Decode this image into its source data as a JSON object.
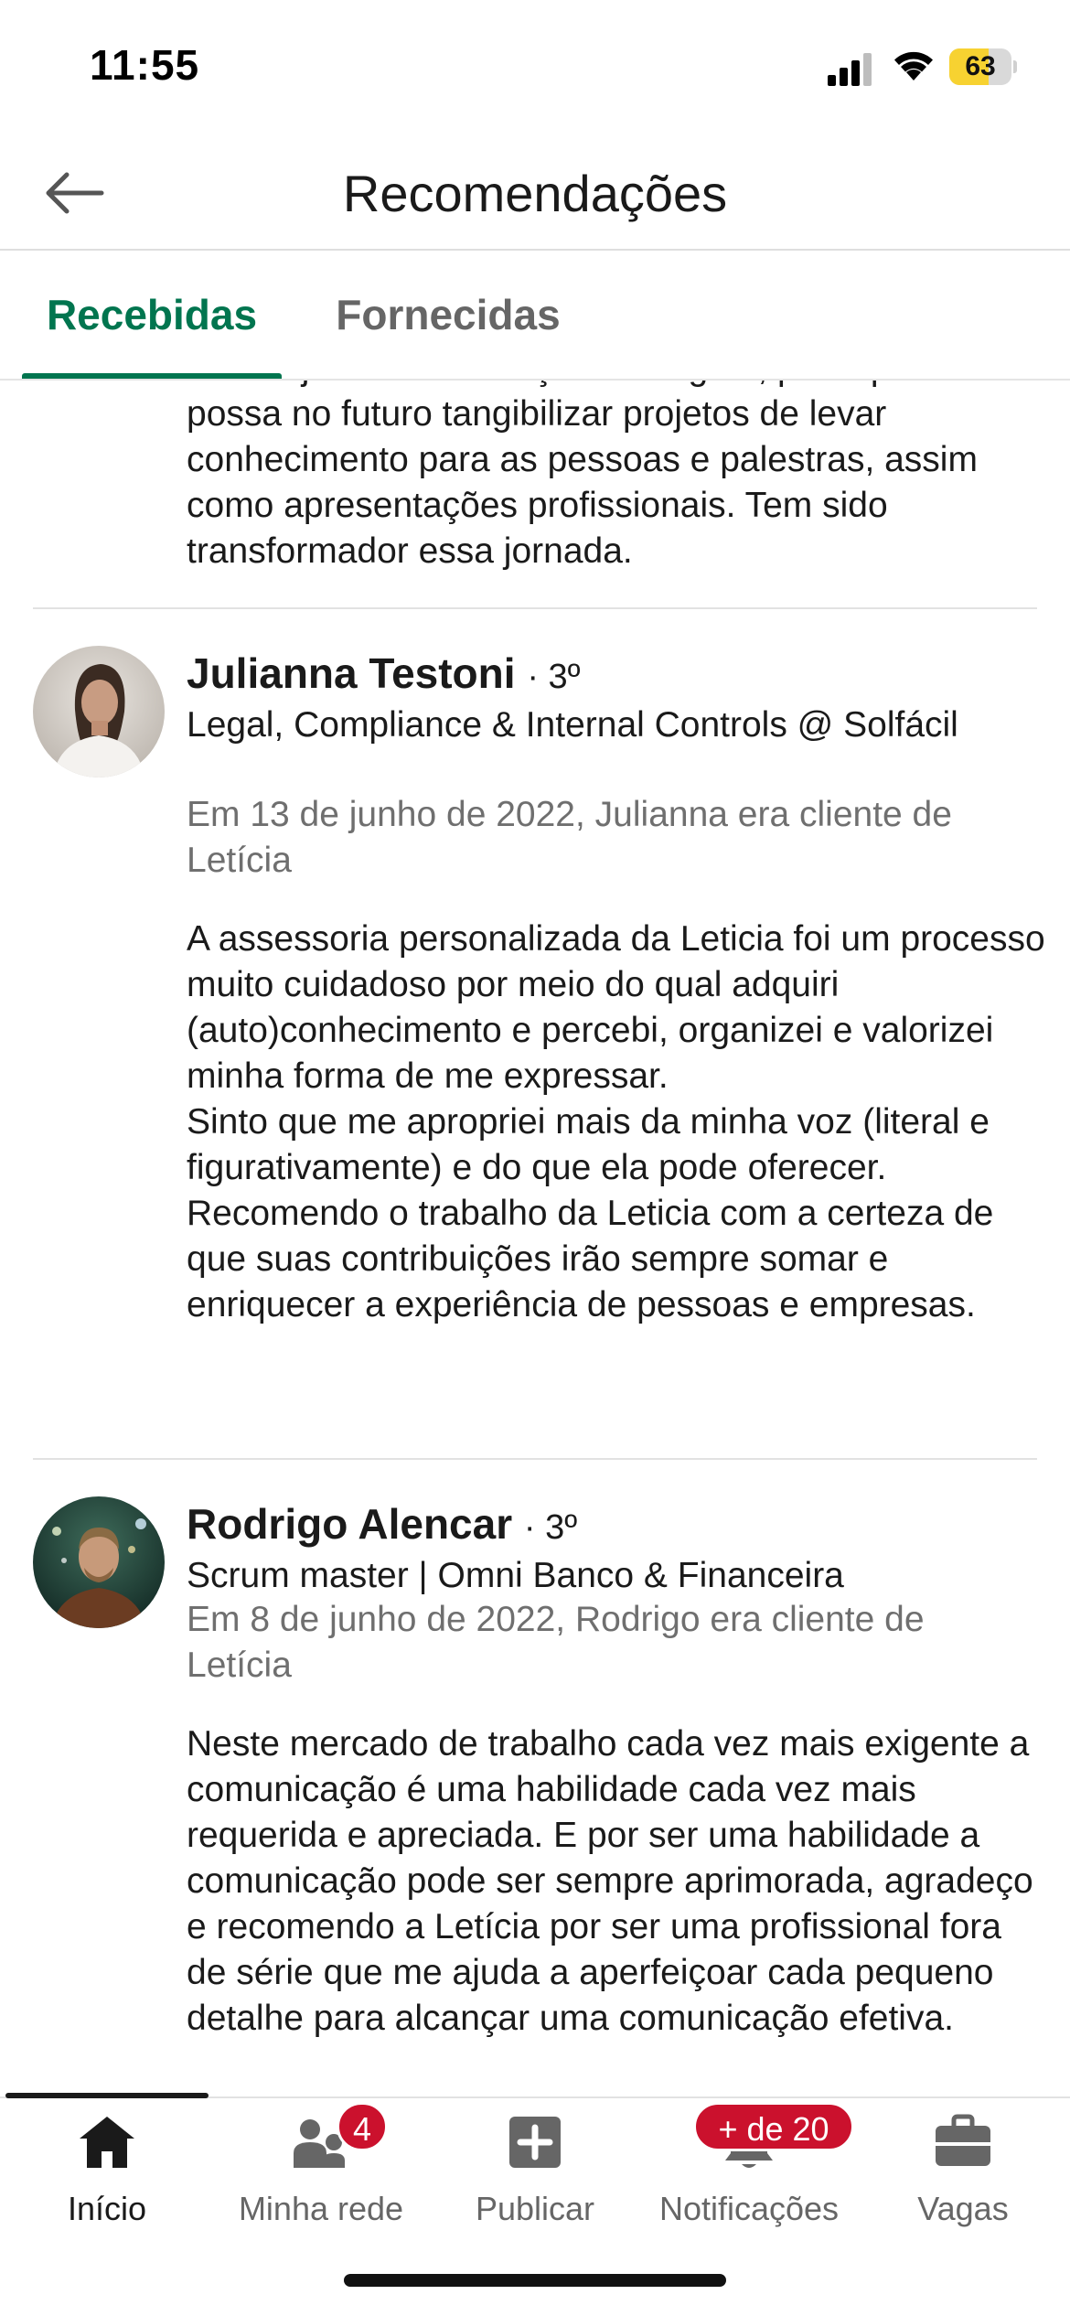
{
  "status_bar": {
    "time": "11:55",
    "battery_level": "63",
    "battery_fraction": 0.63,
    "icons": [
      "signal-icon",
      "wifi-icon",
      "battery-icon"
    ]
  },
  "header": {
    "title": "Recomendações",
    "back_icon": "arrow-left-icon"
  },
  "tabs": [
    {
      "label": "Recebidas",
      "active": true
    },
    {
      "label": "Fornecidas",
      "active": false
    }
  ],
  "previous_recommendation": {
    "text_tail": "na voz junto à articulação e imagem, para que eu possa no futuro tangibilizar projetos de levar conhecimento para as pessoas e palestras, assim como apresentações profissionais. Tem sido transformador essa jornada."
  },
  "recommendations": [
    {
      "name": "Julianna Testoni",
      "degree": "· 3º",
      "headline": "Legal, Compliance & Internal Controls @ Solfácil",
      "relation": "Em 13 de junho de 2022, Julianna era cliente de Letícia",
      "text": "A assessoria personalizada da Leticia foi um processo muito cuidadoso por meio do qual adquiri (auto)conhecimento e percebi, organizei e valorizei minha forma de me expressar.\nSinto que me apropriei mais da minha voz (literal e figurativamente) e do que ela pode oferecer.\nRecomendo o trabalho da Leticia com a certeza de que suas contribuições irão sempre somar e enriquecer a experiência de pessoas e empresas."
    },
    {
      "name": "Rodrigo Alencar",
      "degree": "· 3º",
      "headline": "Scrum master | Omni Banco & Financeira",
      "relation": "Em 8 de junho de 2022, Rodrigo era cliente de Letícia",
      "text": "Neste mercado de trabalho cada vez mais exigente a comunicação é uma habilidade cada vez mais requerida e apreciada. E por ser uma habilidade a comunicação pode ser sempre aprimorada, agradeço e recomendo a Letícia por ser uma profissional fora de série que me ajuda a aperfeiçoar cada pequeno detalhe para alcançar uma comunicação efetiva."
    }
  ],
  "bottom_nav": [
    {
      "label": "Início",
      "icon": "home-icon",
      "active": true,
      "badge": ""
    },
    {
      "label": "Minha rede",
      "icon": "network-icon",
      "active": false,
      "badge": "4"
    },
    {
      "label": "Publicar",
      "icon": "plus-square-icon",
      "active": false,
      "badge": ""
    },
    {
      "label": "Notificações",
      "icon": "bell-icon",
      "active": false,
      "badge": "+ de 20"
    },
    {
      "label": "Vagas",
      "icon": "briefcase-icon",
      "active": false,
      "badge": ""
    }
  ],
  "colors": {
    "accent": "#01754f",
    "badge": "#cb112d",
    "battery": "#f7d231",
    "muted_text": "#6f6f6f"
  }
}
